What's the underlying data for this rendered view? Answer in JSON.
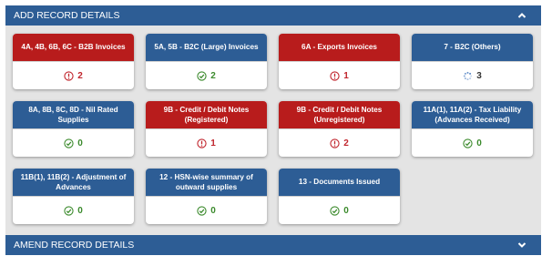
{
  "add_header": {
    "title": "ADD RECORD DETAILS",
    "icon": "chevron-up-icon"
  },
  "amend_header": {
    "title": "AMEND RECORD DETAILS",
    "icon": "chevron-down-icon"
  },
  "colors": {
    "header_blue": "#2d5d95",
    "error_red": "#b81c1c",
    "ok_green": "#3b8a2c"
  },
  "tiles": [
    {
      "title": "4A, 4B, 6B, 6C - B2B Invoices",
      "status": "error",
      "count": "2"
    },
    {
      "title": "5A, 5B - B2C (Large) Invoices",
      "status": "ok",
      "count": "2"
    },
    {
      "title": "6A - Exports Invoices",
      "status": "error",
      "count": "1"
    },
    {
      "title": "7 - B2C (Others)",
      "status": "processing",
      "count": "3"
    },
    {
      "title": "8A, 8B, 8C, 8D - Nil Rated Supplies",
      "status": "ok",
      "count": "0"
    },
    {
      "title": "9B - Credit / Debit Notes (Registered)",
      "status": "error",
      "count": "1"
    },
    {
      "title": "9B - Credit / Debit Notes (Unregistered)",
      "status": "error",
      "count": "2"
    },
    {
      "title": "11A(1), 11A(2) - Tax Liability (Advances Received)",
      "status": "ok",
      "count": "0"
    },
    {
      "title": "11B(1), 11B(2) - Adjustment of Advances",
      "status": "ok",
      "count": "0"
    },
    {
      "title": "12 - HSN-wise summary of outward supplies",
      "status": "ok",
      "count": "0"
    },
    {
      "title": "13 - Documents Issued",
      "status": "ok",
      "count": "0"
    }
  ]
}
